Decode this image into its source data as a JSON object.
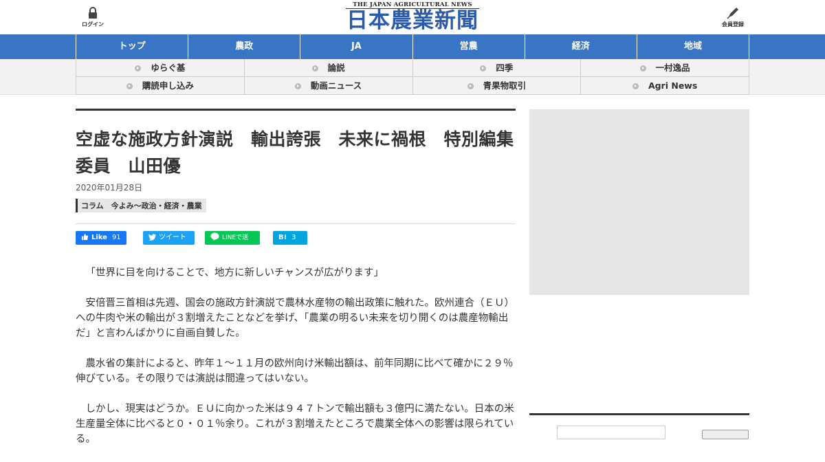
{
  "header": {
    "login_label": "ログイン",
    "register_label": "会員登録",
    "logo_sub": "THE JAPAN AGRICULTURAL NEWS",
    "logo_main": "日本農業新聞"
  },
  "main_nav": [
    {
      "label": "トップ"
    },
    {
      "label": "農政"
    },
    {
      "label": "JA"
    },
    {
      "label": "営農"
    },
    {
      "label": "経済"
    },
    {
      "label": "地域"
    }
  ],
  "sub_nav": [
    {
      "label": "ゆらぐ基"
    },
    {
      "label": "論説"
    },
    {
      "label": "四季"
    },
    {
      "label": "一村逸品"
    },
    {
      "label": "購読申し込み"
    },
    {
      "label": "動画ニュース"
    },
    {
      "label": "青果物取引"
    },
    {
      "label": "Agri News"
    }
  ],
  "article": {
    "title": "空虚な施政方針演説　輸出誇張　未来に禍根　特別編集委員　山田優",
    "date": "2020年01月28日",
    "category": "コラム　今よみ～政治・経済・農業",
    "paragraphs": [
      "「世界に目を向けることで、地方に新しいチャンスが広がります」",
      "安倍晋三首相は先週、国会の施政方針演説で農林水産物の輸出政策に触れた。欧州連合（ＥＵ）への牛肉や米の輸出が３割増えたことなどを挙げ、「農業の明るい未来を切り開くのは農産物輸出だ」と言わんばかりに自画自賛した。",
      "農水省の集計によると、昨年１～１１月の欧州向け米輸出額は、前年同期に比べて確かに２９％伸びている。その限りでは演説は間違ってはいない。",
      "しかし、現実はどうか。ＥＵに向かった米は９４７トンで輸出額も３億円に満たない。日本の米生産量全体に比べると０・０１％余り。これが３割増えたところで農業全体への影響は限られている。"
    ]
  },
  "share": {
    "facebook_label": "Like",
    "facebook_count": "91",
    "twitter_label": "ツイート",
    "line_label": "LINEで送る",
    "hatena_label": "B!",
    "hatena_count": "3"
  },
  "colors": {
    "nav_blue": "#3a74c4",
    "logo_blue": "#2a5aa8",
    "facebook": "#1877f2",
    "twitter": "#1da1f2",
    "line": "#06c755",
    "hatena": "#00a4de"
  }
}
